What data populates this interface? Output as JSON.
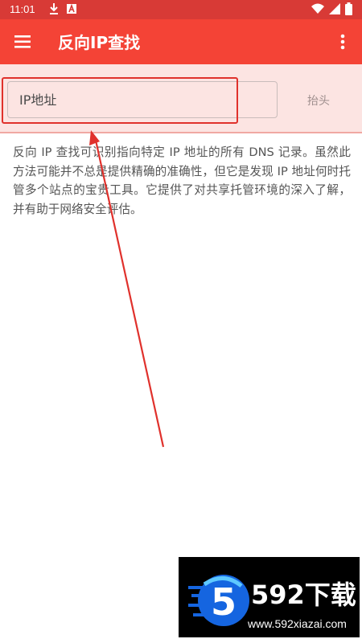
{
  "status_bar": {
    "time": "11:01",
    "icons_left": [
      "download-icon",
      "a-notification-icon"
    ],
    "icons_right": [
      "wifi-icon",
      "signal-icon",
      "battery-icon"
    ]
  },
  "app_bar": {
    "title": "反向IP查找",
    "color": "#f44336",
    "menu_icon": "hamburger-menu-icon",
    "more_icon": "more-vert-icon"
  },
  "form": {
    "input_placeholder": "IP地址",
    "input_value": "",
    "header_button_label": "抬头"
  },
  "description": "反向 IP 查找可识别指向特定 IP 地址的所有 DNS 记录。虽然此方法可能并不总是提供精确的准确性，但它是发现 IP 地址何时托管多个站点的宝贵工具。它提供了对共享托管环境的深入了解，并有助于网络安全评估。",
  "watermark": {
    "logo_digit": "5",
    "brand": "592下载",
    "url": "www.592xiazai.com"
  },
  "annotation": {
    "color": "#e0312c"
  }
}
